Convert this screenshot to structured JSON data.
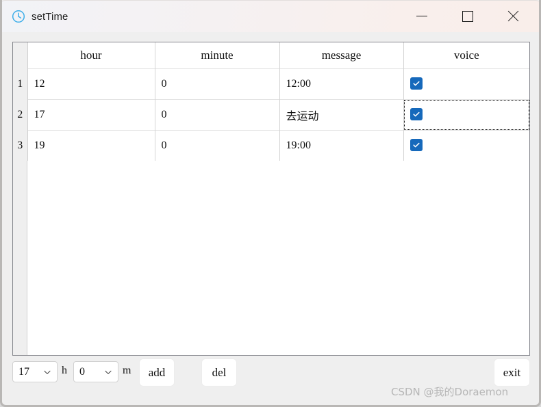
{
  "window": {
    "title": "setTime",
    "icon": "clock-icon",
    "controls": {
      "minimize": "minimize-icon",
      "maximize": "maximize-icon",
      "close": "close-icon"
    }
  },
  "table": {
    "rownum_header": "",
    "columns": [
      "hour",
      "minute",
      "message",
      "voice"
    ],
    "rows": [
      {
        "index": "1",
        "hour": "12",
        "minute": "0",
        "message": "12:00",
        "voice": true,
        "focused": false
      },
      {
        "index": "2",
        "hour": "17",
        "minute": "0",
        "message": "去运动",
        "voice": true,
        "focused": true
      },
      {
        "index": "3",
        "hour": "19",
        "minute": "0",
        "message": "19:00",
        "voice": true,
        "focused": false
      }
    ]
  },
  "toolbar": {
    "hour_value": "17",
    "minute_value": "0",
    "hour_unit": "h",
    "minute_unit": "m",
    "add_label": "add",
    "del_label": "del",
    "exit_label": "exit",
    "dropdown_icon": "chevron-down-icon"
  },
  "watermark": "CSDN @我的Doraemon",
  "colors": {
    "checkbox_blue": "#1669bb",
    "titlebar_accent": "#f9eeea",
    "app_icon_blue": "#3daee9",
    "content_bg": "#efefef"
  }
}
